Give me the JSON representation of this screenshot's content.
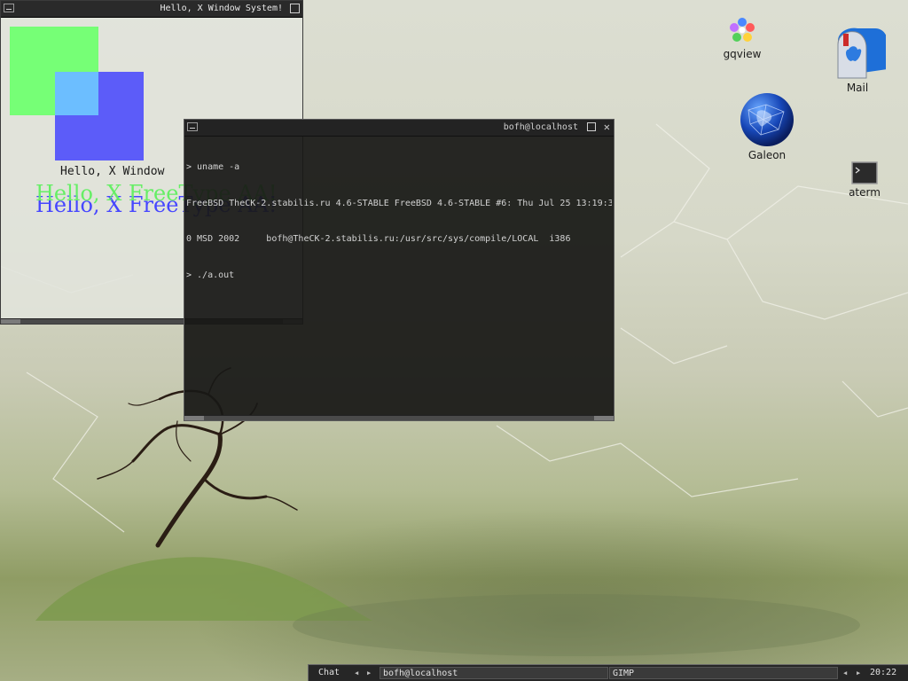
{
  "hello_window": {
    "title": "Hello, X Window System!",
    "core_text": "Hello, X Window",
    "aa_text": "Hello, X FreeType AA!"
  },
  "terminal": {
    "title": "bofh@localhost",
    "lines": [
      "> uname -a",
      "FreeBSD TheCK-2.stabilis.ru 4.6-STABLE FreeBSD 4.6-STABLE #6: Thu Jul 25 13:19:3",
      "0 MSD 2002     bofh@TheCK-2.stabilis.ru:/usr/src/sys/compile/LOCAL  i386",
      "> ./a.out"
    ]
  },
  "desktop_icons": [
    {
      "label": "gqview",
      "icon": "flower-icon"
    },
    {
      "label": "Mail",
      "icon": "mailbox-icon"
    },
    {
      "label": "Galeon",
      "icon": "globe-icon"
    },
    {
      "label": "aterm",
      "icon": "terminal-icon"
    }
  ],
  "taskbar": {
    "desk_label": "Chat",
    "tasks": [
      "bofh@localhost",
      "GIMP"
    ],
    "clock": "20:22"
  },
  "colors": {
    "hello_green": "#76ff76",
    "hello_blue": "#3e3eff",
    "terminal_bg": "#181816",
    "taskbar_bg": "#262626"
  }
}
